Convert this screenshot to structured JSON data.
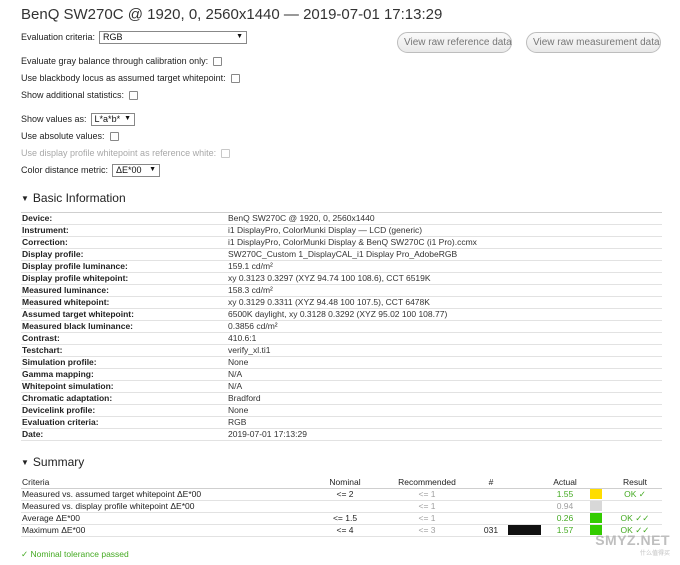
{
  "title": "BenQ SW270C @ 1920, 0, 2560x1440 — 2019-07-01 17:13:29",
  "buttons": {
    "raw_reference": "View raw reference data",
    "raw_measurement": "View raw measurement data"
  },
  "options": {
    "evaluation_criteria_label": "Evaluation criteria:",
    "evaluation_criteria_value": "RGB",
    "gray_balance_label": "Evaluate gray balance through calibration only:",
    "blackbody_label": "Use blackbody locus as assumed target whitepoint:",
    "additional_stats_label": "Show additional statistics:",
    "show_values_label": "Show values as:",
    "show_values_value": "L*a*b*",
    "absolute_values_label": "Use absolute values:",
    "display_profile_wp_label": "Use display profile whitepoint as reference white:",
    "color_distance_label": "Color distance metric:",
    "color_distance_value": "ΔE*00"
  },
  "basic_info": {
    "heading": "Basic Information",
    "rows": [
      {
        "k": "Device:",
        "v": "BenQ SW270C @ 1920, 0, 2560x1440"
      },
      {
        "k": "Instrument:",
        "v": "i1 DisplayPro, ColorMunki Display — LCD (generic)"
      },
      {
        "k": "Correction:",
        "v": "i1 DisplayPro, ColorMunki Display & BenQ SW270C (i1 Pro).ccmx"
      },
      {
        "k": "Display profile:",
        "v": "SW270C_Custom 1_DisplayCAL_i1 Display Pro_AdobeRGB"
      },
      {
        "k": "Display profile luminance:",
        "v": "159.1 cd/m²"
      },
      {
        "k": "Display profile whitepoint:",
        "v": "xy 0.3123 0.3297 (XYZ 94.74 100 108.6), CCT 6519K"
      },
      {
        "k": "Measured luminance:",
        "v": "158.3 cd/m²"
      },
      {
        "k": "Measured whitepoint:",
        "v": "xy 0.3129 0.3311 (XYZ 94.48 100 107.5), CCT 6478K"
      },
      {
        "k": "Assumed target whitepoint:",
        "v": "6500K daylight, xy 0.3128 0.3292 (XYZ 95.02 100 108.77)"
      },
      {
        "k": "Measured black luminance:",
        "v": "0.3856 cd/m²"
      },
      {
        "k": "Contrast:",
        "v": "410.6:1"
      },
      {
        "k": "Testchart:",
        "v": "verify_xl.ti1"
      },
      {
        "k": "Simulation profile:",
        "v": "None"
      },
      {
        "k": "Gamma mapping:",
        "v": "N/A"
      },
      {
        "k": "Whitepoint simulation:",
        "v": "N/A"
      },
      {
        "k": "Chromatic adaptation:",
        "v": "Bradford"
      },
      {
        "k": "Devicelink profile:",
        "v": "None"
      },
      {
        "k": "Evaluation criteria:",
        "v": "RGB"
      },
      {
        "k": "Date:",
        "v": "2019-07-01 17:13:29"
      }
    ]
  },
  "summary": {
    "heading": "Summary",
    "columns": {
      "criteria": "Criteria",
      "nominal": "Nominal",
      "recommended": "Recommended",
      "hash": "#",
      "actual": "Actual",
      "result": "Result"
    },
    "rows": [
      {
        "criteria": "Measured vs. assumed target whitepoint ΔE*00",
        "nominal": "<= 2",
        "recommended": "<= 1",
        "hash": "",
        "actual": "1.55",
        "result": "OK ✓",
        "swatch": "#ffdd00"
      },
      {
        "criteria": "Measured vs. display profile whitepoint ΔE*00",
        "nominal": "",
        "recommended": "<= 1",
        "hash": "",
        "actual": "0.94",
        "result": "",
        "swatch": "#d8d8d8"
      },
      {
        "criteria": "Average ΔE*00",
        "nominal": "<= 1.5",
        "recommended": "<= 1",
        "hash": "",
        "actual": "0.26",
        "result": "OK ✓✓",
        "swatch": "#33cc00"
      },
      {
        "criteria": "Maximum ΔE*00",
        "nominal": "<= 4",
        "recommended": "<= 3",
        "hash": "031",
        "actual": "1.57",
        "result": "OK ✓✓",
        "swatch": "#33cc00"
      }
    ],
    "passed": "✓ Nominal tolerance passed"
  },
  "watermark": {
    "text": "SMYZ.NET",
    "sub": "什么值得买"
  }
}
